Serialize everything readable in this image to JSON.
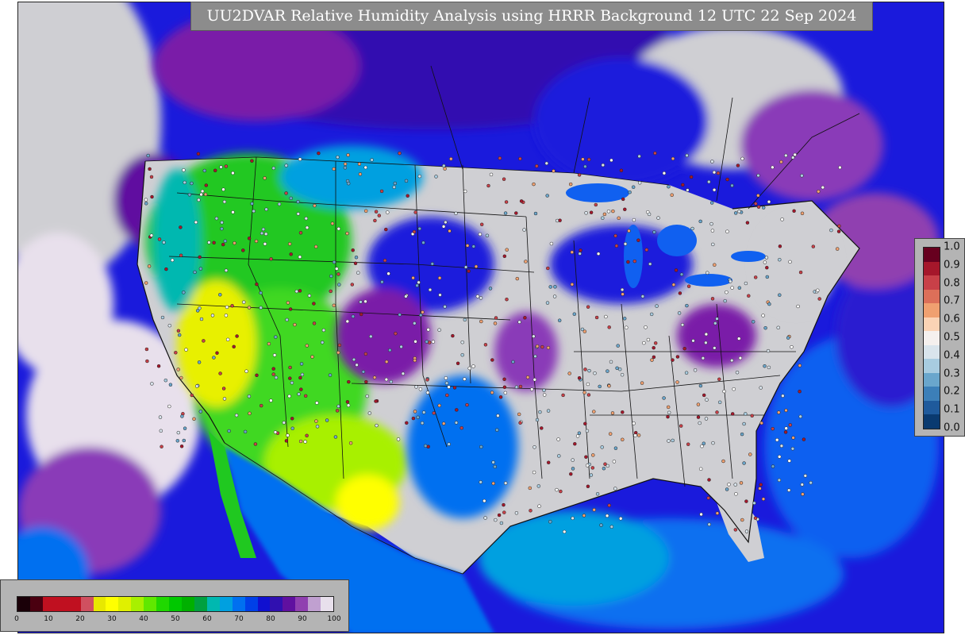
{
  "title": "UU2DVAR Relative Humidity Analysis using HRRR Background 12 UTC 22 Sep 2024",
  "ratio_legend": {
    "ticks": [
      "1.0",
      "0.9",
      "0.8",
      "0.7",
      "0.6",
      "0.5",
      "0.4",
      "0.3",
      "0.2",
      "0.1",
      "0.0"
    ],
    "colors_top_to_bottom": [
      "#67001f",
      "#a5172b",
      "#c84048",
      "#dc6f59",
      "#f0a070",
      "#fbd3b5",
      "#f5f0ee",
      "#d9e4ec",
      "#a8cce0",
      "#6aa6cc",
      "#3c7fb8",
      "#1f5a9c",
      "#0a3a70"
    ]
  },
  "rh_legend": {
    "ticks": [
      "0",
      "10",
      "20",
      "30",
      "40",
      "50",
      "60",
      "70",
      "80",
      "90",
      "100"
    ],
    "colors": [
      "#1a0008",
      "#4a0010",
      "#c01020",
      "#c01020",
      "#c01020",
      "#d05060",
      "#e8e800",
      "#ffff00",
      "#e0f000",
      "#a8f000",
      "#60e800",
      "#20d800",
      "#00c800",
      "#00b000",
      "#00a040",
      "#00b8b0",
      "#00a0e0",
      "#0070f0",
      "#0040e8",
      "#1010d0",
      "#3010b0",
      "#6010a0",
      "#9040b0",
      "#c0a0d0",
      "#e8e0ec"
    ]
  },
  "colors": {
    "land": "#cfcfd3",
    "ocean_deep": "#1a1adc",
    "ocean_mid": "#1060f0",
    "moist_purple": "#7a1aa8",
    "dry_green": "#20d020",
    "very_dry_yellow": "#e8f000"
  }
}
